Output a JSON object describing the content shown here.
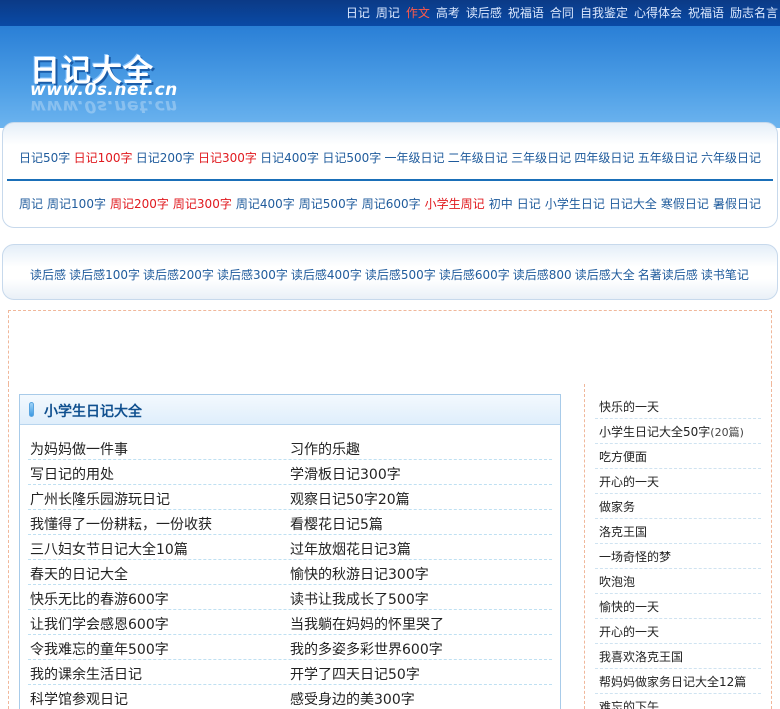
{
  "top_nav": [
    {
      "label": "日记",
      "hot": false
    },
    {
      "label": "周记",
      "hot": false
    },
    {
      "label": "作文",
      "hot": true
    },
    {
      "label": "高考",
      "hot": false
    },
    {
      "label": "读后感",
      "hot": false
    },
    {
      "label": "祝福语",
      "hot": false
    },
    {
      "label": "合同",
      "hot": false
    },
    {
      "label": "自我鉴定",
      "hot": false
    },
    {
      "label": "心得体会",
      "hot": false
    },
    {
      "label": "祝福语",
      "hot": false
    },
    {
      "label": "励志名言",
      "hot": false
    }
  ],
  "logo": {
    "title": "日记大全",
    "url": "www.0s.net.cn"
  },
  "nav_row1": [
    {
      "label": "日记50字",
      "hot": false
    },
    {
      "label": "日记100字",
      "hot": true
    },
    {
      "label": "日记200字",
      "hot": false
    },
    {
      "label": "日记300字",
      "hot": true
    },
    {
      "label": "日记400字",
      "hot": false
    },
    {
      "label": "日记500字",
      "hot": false
    },
    {
      "label": "一年级日记",
      "hot": false
    },
    {
      "label": "二年级日记",
      "hot": false
    },
    {
      "label": "三年级日记",
      "hot": false
    },
    {
      "label": "四年级日记",
      "hot": false
    },
    {
      "label": "五年级日记",
      "hot": false
    },
    {
      "label": "六年级日记",
      "hot": false
    }
  ],
  "nav_row2": [
    {
      "label": "周记",
      "hot": false
    },
    {
      "label": "周记100字",
      "hot": false
    },
    {
      "label": "周记200字",
      "hot": true
    },
    {
      "label": "周记300字",
      "hot": true
    },
    {
      "label": "周记400字",
      "hot": false
    },
    {
      "label": "周记500字",
      "hot": false
    },
    {
      "label": "周记600字",
      "hot": false
    },
    {
      "label": "小学生周记",
      "hot": true
    },
    {
      "label": "初中",
      "hot": false
    },
    {
      "label": "日记",
      "hot": false
    },
    {
      "label": "小学生日记",
      "hot": false
    },
    {
      "label": "日记大全",
      "hot": false
    },
    {
      "label": "寒假日记",
      "hot": false
    },
    {
      "label": "暑假日记",
      "hot": false
    }
  ],
  "nav_row3": [
    {
      "label": "读后感",
      "hot": false
    },
    {
      "label": "读后感100字",
      "hot": false
    },
    {
      "label": "读后感200字",
      "hot": false
    },
    {
      "label": "读后感300字",
      "hot": false
    },
    {
      "label": "读后感400字",
      "hot": false
    },
    {
      "label": "读后感500字",
      "hot": false
    },
    {
      "label": "读后感600字",
      "hot": false
    },
    {
      "label": "读后感800",
      "hot": false
    },
    {
      "label": "读后感大全",
      "hot": false
    },
    {
      "label": "名著读后感",
      "hot": false
    },
    {
      "label": "读书笔记",
      "hot": false
    }
  ],
  "section": {
    "title": "小学生日记大全",
    "articles": [
      [
        "为妈妈做一件事",
        "习作的乐趣"
      ],
      [
        "写日记的用处",
        "学滑板日记300字"
      ],
      [
        "广州长隆乐园游玩日记",
        "观察日记50字20篇"
      ],
      [
        "我懂得了一份耕耘，一份收获",
        "看樱花日记5篇"
      ],
      [
        "三八妇女节日记大全10篇",
        "过年放烟花日记3篇"
      ],
      [
        "春天的日记大全",
        "愉快的秋游日记300字"
      ],
      [
        "快乐无比的春游600字",
        "读书让我成长了500字"
      ],
      [
        "让我们学会感恩600字",
        "当我躺在妈妈的怀里哭了"
      ],
      [
        "令我难忘的童年500字",
        "我的多姿多彩世界600字"
      ],
      [
        "我的课余生活日记",
        "开学了四天日记50字"
      ],
      [
        "科学馆参观日记",
        "感受身边的美300字"
      ]
    ]
  },
  "side_list": [
    {
      "label": "快乐的一天",
      "count": ""
    },
    {
      "label": "小学生日记大全50字",
      "count": "(20篇)"
    },
    {
      "label": "吃方便面",
      "count": ""
    },
    {
      "label": "开心的一天",
      "count": ""
    },
    {
      "label": "做家务",
      "count": ""
    },
    {
      "label": "洛克王国",
      "count": ""
    },
    {
      "label": "一场奇怪的梦",
      "count": ""
    },
    {
      "label": "吹泡泡",
      "count": ""
    },
    {
      "label": "愉快的一天",
      "count": ""
    },
    {
      "label": "开心的一天",
      "count": ""
    },
    {
      "label": "我喜欢洛克王国",
      "count": ""
    },
    {
      "label": "帮妈妈做家务日记大全12篇",
      "count": ""
    },
    {
      "label": "难忘的下午",
      "count": ""
    }
  ],
  "colors": {
    "link": "#1f5b9c",
    "hot": "#e0191e",
    "header_blue": "#2a7fd6"
  }
}
